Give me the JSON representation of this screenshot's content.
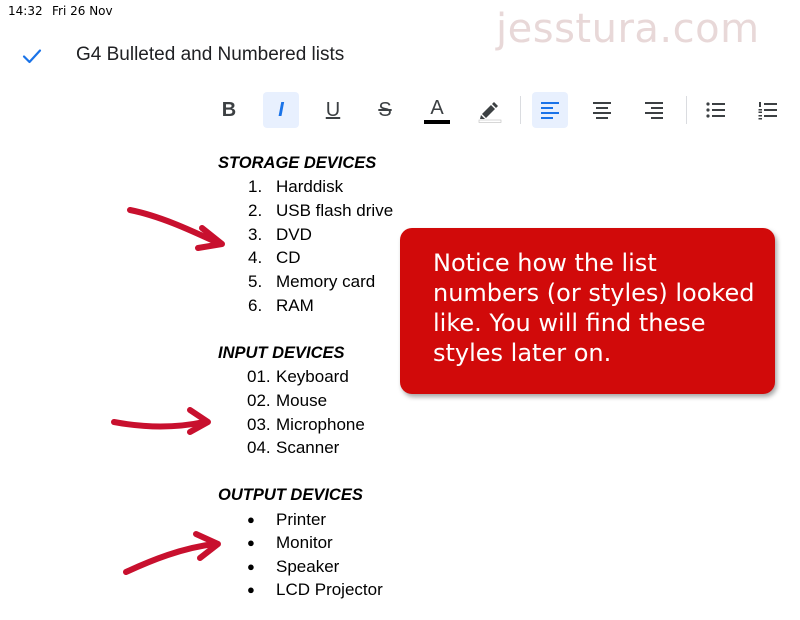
{
  "status_bar": {
    "time": "14:32",
    "date": "Fri 26 Nov"
  },
  "watermark": "jesstura.com",
  "header": {
    "done_icon": "check-icon",
    "doc_title": "G4 Bulleted and Numbered lists"
  },
  "toolbar": {
    "bold": "B",
    "italic": "I",
    "underline": "U",
    "strikethrough": "S",
    "text_color": "A",
    "text_color_value": "#000000",
    "highlight_icon": "highlighter-icon",
    "align_left_icon": "align-left-icon",
    "align_center_icon": "align-center-icon",
    "align_right_icon": "align-right-icon",
    "bulleted_list_icon": "bulleted-list-icon",
    "numbered_list_icon": "numbered-list-icon",
    "active_color": "#1a73e8"
  },
  "document": {
    "storage": {
      "heading": "STORAGE DEVICES",
      "items": [
        {
          "marker": "1.",
          "text": "Harddisk"
        },
        {
          "marker": "2.",
          "text": "USB flash drive"
        },
        {
          "marker": "3.",
          "text": "DVD"
        },
        {
          "marker": "4.",
          "text": "CD"
        },
        {
          "marker": "5.",
          "text": "Memory card"
        },
        {
          "marker": "6.",
          "text": "RAM"
        }
      ]
    },
    "input": {
      "heading": "INPUT DEVICES",
      "items": [
        {
          "marker": "01.",
          "text": "Keyboard"
        },
        {
          "marker": "02.",
          "text": "Mouse"
        },
        {
          "marker": "03.",
          "text": "Microphone"
        },
        {
          "marker": "04.",
          "text": "Scanner"
        }
      ]
    },
    "output": {
      "heading": "OUTPUT DEVICES",
      "items": [
        {
          "marker": "●",
          "text": "Printer"
        },
        {
          "marker": "●",
          "text": "Monitor"
        },
        {
          "marker": "●",
          "text": "Speaker"
        },
        {
          "marker": "●",
          "text": "LCD Projector"
        }
      ]
    }
  },
  "callout": {
    "text": "Notice how the list numbers (or styles) looked like. You will find these styles later on.",
    "background": "#d10a0a"
  },
  "annotations": {
    "arrow_color": "#d10a0a"
  }
}
